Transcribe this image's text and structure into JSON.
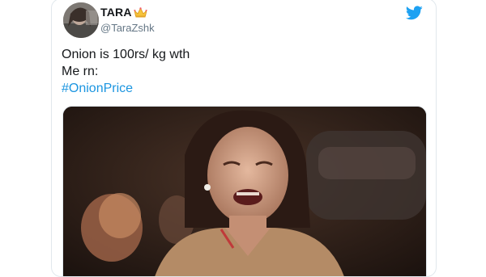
{
  "tweet": {
    "display_name": "TARA",
    "handle": "@TaraZshk",
    "lines": [
      "Onion is 100rs/ kg wth",
      "Me rn:"
    ],
    "hashtag": "#OnionPrice",
    "icons": {
      "crown": "crown-icon",
      "platform": "twitter-bird-icon"
    },
    "media": {
      "type": "photo",
      "description_icon": "image"
    }
  },
  "colors": {
    "link": "#1b95e0",
    "twitter_blue": "#1da1f2",
    "handle_gray": "#657786",
    "border": "#e1e8ed"
  }
}
